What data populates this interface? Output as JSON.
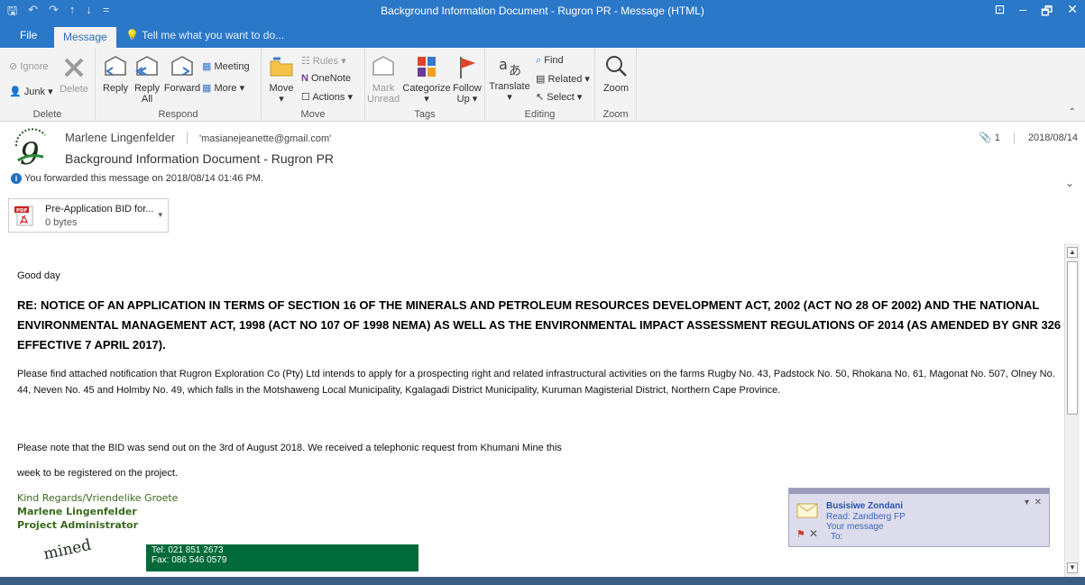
{
  "window": {
    "title": "Background Information Document - Rugron PR - Message (HTML)",
    "qat": [
      "🖫",
      "↶",
      "↷",
      "↑",
      "↓",
      "="
    ],
    "controls": [
      "⊡",
      "–",
      "🗗",
      "✕"
    ]
  },
  "tabs": {
    "file": "File",
    "message": "Message",
    "tell": "Tell me what you want to do..."
  },
  "ribbon": {
    "delete": {
      "label": "Delete",
      "ignore": "Ignore",
      "junk": "Junk",
      "delete_btn": "Delete"
    },
    "respond": {
      "label": "Respond",
      "reply": "Reply",
      "reply_all_1": "Reply",
      "reply_all_2": "All",
      "forward": "Forward",
      "meeting": "Meeting",
      "more": "More"
    },
    "move": {
      "label": "Move",
      "move_btn": "Move",
      "rules": "Rules",
      "onenote": "OneNote",
      "actions": "Actions"
    },
    "tags": {
      "label": "Tags",
      "mark_unread_1": "Mark",
      "mark_unread_2": "Unread",
      "categorize": "Categorize",
      "follow_up_1": "Follow",
      "follow_up_2": "Up"
    },
    "editing": {
      "label": "Editing",
      "translate": "Translate",
      "find": "Find",
      "related": "Related",
      "select": "Select"
    },
    "zoom": {
      "label": "Zoom",
      "zoom_btn": "Zoom"
    }
  },
  "header": {
    "sender": "Marlene Lingenfelder",
    "to": "'masianejeanette@gmail.com'",
    "subject": "Background Information Document - Rugron PR",
    "forwarded": "You forwarded this message on 2018/08/14 01:46 PM.",
    "attach_count": "1",
    "date": "2018/08/14"
  },
  "attachment": {
    "name": "Pre-Application BID for...",
    "size": "0 bytes",
    "type": "PDF"
  },
  "body": {
    "greeting": "Good day",
    "heading": "RE: NOTICE OF AN APPLICATION IN TERMS OF SECTION 16 OF THE MINERALS AND PETROLEUM RESOURCES DEVELOPMENT ACT, 2002 (ACT NO 28 OF 2002) AND THE NATIONAL ENVIRONMENTAL MANAGEMENT ACT, 1998 (ACT NO 107 OF 1998 NEMA) AS WELL AS THE ENVIRONMENTAL IMPACT ASSESSMENT REGULATIONS OF 2014 (AS AMENDED BY GNR 326 EFFECTIVE 7 APRIL 2017).",
    "paragraph": "Please find attached notification that Rugron Exploration Co (Pty) Ltd intends to apply for a prospecting right and related infrastructural activities on the farms Rugby No. 43, Padstock No. 50, Rhokana No. 61, Magonat No. 507, Olney No. 44, Neven No. 45 and Holmby No. 49, which falls in the Motshaweng Local Municipality, Kgalagadi District Municipality, Kuruman Magisterial District, Northern Cape Province.",
    "note_1": "Please note that the BID was send out on the 3rd of August 2018. We received a telephonic request from Khumani Mine this",
    "note_2": "week to be registered on the project.",
    "regards": "Kind Regards/Vriendelike Groete",
    "sig_name": "Marlene Lingenfelder",
    "sig_title": "Project Administrator",
    "tel": "Tel: 021 851 2673",
    "fax": "Fax: 086 546 0579",
    "logo_text": "mined"
  },
  "toast": {
    "name": "Busisiwe Zondani",
    "line1": "Read: Zandberg FP",
    "line2": "Your message",
    "line3": "To:"
  },
  "colors": {
    "accent": "#2b78c8",
    "signature_green": "#3a6a1e",
    "banner_green": "#006a3a"
  }
}
